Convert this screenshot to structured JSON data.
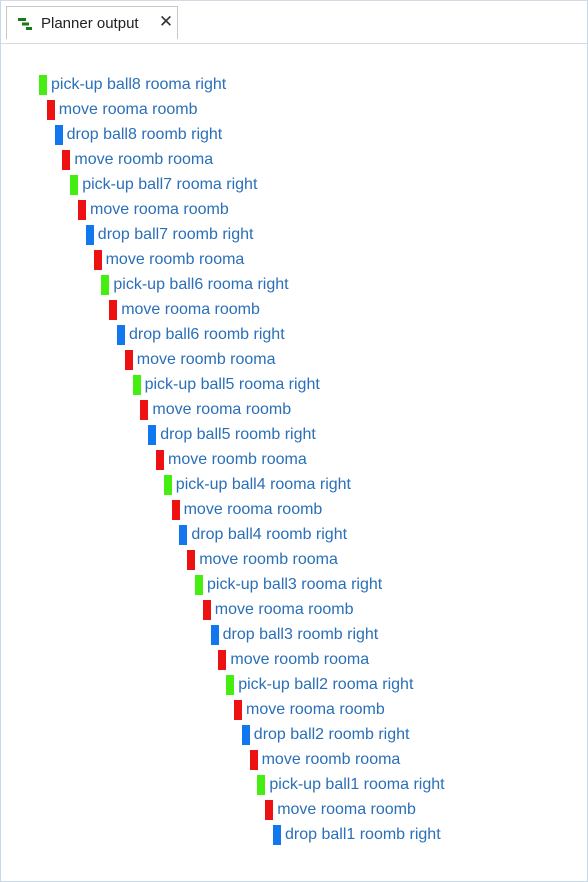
{
  "tab": {
    "title": "Planner output",
    "icon": "gantt-chart-icon",
    "close_glyph": "✕"
  },
  "colors": {
    "pick-up": "#44ee11",
    "move": "#ee1111",
    "drop": "#1177ee",
    "text": "#2a6fb8"
  },
  "plan_steps": [
    {
      "action": "pick-up",
      "label": "pick-up ball8 rooma right"
    },
    {
      "action": "move",
      "label": "move rooma roomb"
    },
    {
      "action": "drop",
      "label": "drop ball8 roomb right"
    },
    {
      "action": "move",
      "label": "move roomb rooma"
    },
    {
      "action": "pick-up",
      "label": "pick-up ball7 rooma right"
    },
    {
      "action": "move",
      "label": "move rooma roomb"
    },
    {
      "action": "drop",
      "label": "drop ball7 roomb right"
    },
    {
      "action": "move",
      "label": "move roomb rooma"
    },
    {
      "action": "pick-up",
      "label": "pick-up ball6 rooma right"
    },
    {
      "action": "move",
      "label": "move rooma roomb"
    },
    {
      "action": "drop",
      "label": "drop ball6 roomb right"
    },
    {
      "action": "move",
      "label": "move roomb rooma"
    },
    {
      "action": "pick-up",
      "label": "pick-up ball5 rooma right"
    },
    {
      "action": "move",
      "label": "move rooma roomb"
    },
    {
      "action": "drop",
      "label": "drop ball5 roomb right"
    },
    {
      "action": "move",
      "label": "move roomb rooma"
    },
    {
      "action": "pick-up",
      "label": "pick-up ball4 rooma right"
    },
    {
      "action": "move",
      "label": "move rooma roomb"
    },
    {
      "action": "drop",
      "label": "drop ball4 roomb right"
    },
    {
      "action": "move",
      "label": "move roomb rooma"
    },
    {
      "action": "pick-up",
      "label": "pick-up ball3 rooma right"
    },
    {
      "action": "move",
      "label": "move rooma roomb"
    },
    {
      "action": "drop",
      "label": "drop ball3 roomb right"
    },
    {
      "action": "move",
      "label": "move roomb rooma"
    },
    {
      "action": "pick-up",
      "label": "pick-up ball2 rooma right"
    },
    {
      "action": "move",
      "label": "move rooma roomb"
    },
    {
      "action": "drop",
      "label": "drop ball2 roomb right"
    },
    {
      "action": "move",
      "label": "move roomb rooma"
    },
    {
      "action": "pick-up",
      "label": "pick-up ball1 rooma right"
    },
    {
      "action": "move",
      "label": "move rooma roomb"
    },
    {
      "action": "drop",
      "label": "drop ball1 roomb right"
    }
  ]
}
